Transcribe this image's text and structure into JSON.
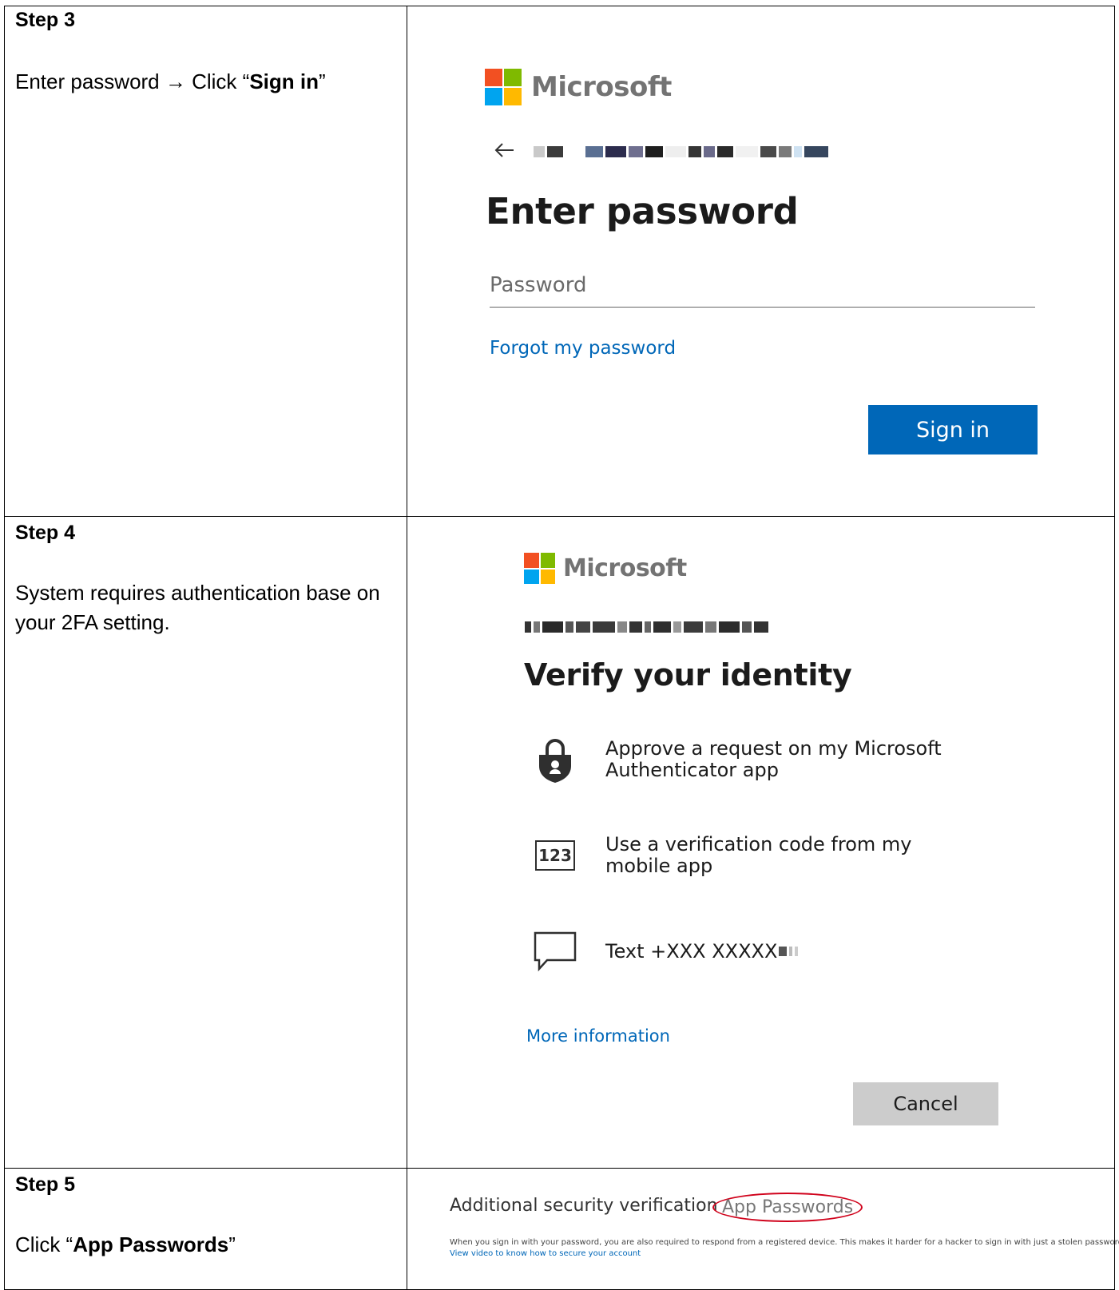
{
  "steps": [
    {
      "title": "Step 3",
      "desc_prefix": "Enter password ",
      "arrow": "→",
      "desc_mid": " Click “",
      "desc_bold": "Sign in",
      "desc_suffix": "”"
    },
    {
      "title": "Step 4",
      "desc": "System requires authentication base on your 2FA setting."
    },
    {
      "title": "Step 5",
      "desc_prefix": "Click “",
      "desc_bold": "App Passwords",
      "desc_suffix": "”"
    }
  ],
  "signin": {
    "brand": "Microsoft",
    "back_icon": "back-arrow-icon",
    "heading": "Enter password",
    "password_placeholder": "Password",
    "forgot_link": "Forgot my password",
    "signin_button": "Sign in"
  },
  "verify": {
    "brand": "Microsoft",
    "heading": "Verify your identity",
    "options": [
      {
        "icon": "authenticator-lock-icon",
        "label": "Approve a request on my Microsoft Authenticator app"
      },
      {
        "icon": "code-123-icon",
        "label": "Use a verification code from my mobile app",
        "icon_text": "123"
      },
      {
        "icon": "message-bubble-icon",
        "label": "Text +XXX XXXXX"
      }
    ],
    "more_info": "More information",
    "cancel_button": "Cancel"
  },
  "security": {
    "title": "Additional security verification",
    "app_passwords": "App Passwords",
    "fine_print": "When you sign in with your password, you are also required to respond from a registered device. This makes it harder for a hacker to sign in with just a stolen password.",
    "video_link": "View video to know how to secure your account"
  },
  "colors": {
    "ms_red": "#f25022",
    "ms_green": "#7fba00",
    "ms_blue": "#00a4ef",
    "ms_yellow": "#ffb900",
    "link_blue": "#0067b8",
    "highlight_red": "#d0021b"
  }
}
